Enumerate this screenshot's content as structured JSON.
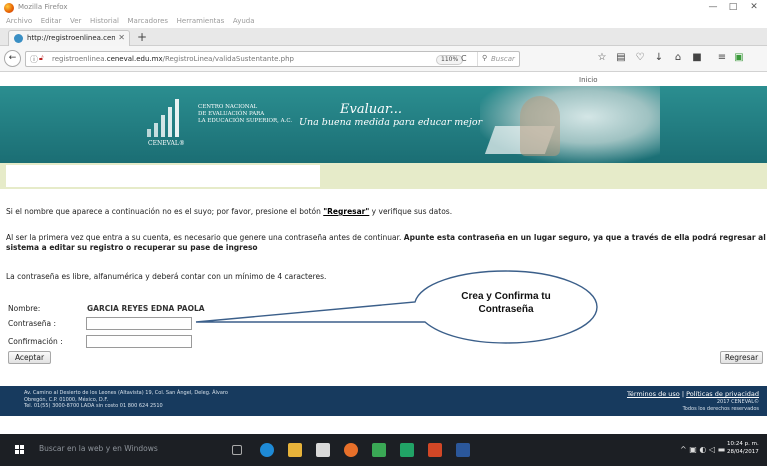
{
  "window": {
    "title": "Mozilla Firefox",
    "minimize": "—",
    "maximize": "□",
    "close": "✕"
  },
  "menu": [
    "Archivo",
    "Editar",
    "Ver",
    "Historial",
    "Marcadores",
    "Herramientas",
    "Ayuda"
  ],
  "tab": {
    "title": "http://registroenlinea.cenev",
    "close": "✕",
    "new_tab": "+"
  },
  "nav": {
    "back": "←",
    "url_domain_prefix": "registroenlinea.",
    "url_domain": "ceneval.edu.mx",
    "url_path": "/RegistroLinea/validaSustentante.php",
    "zoom": "110%",
    "reload": "C",
    "search_placeholder": "Buscar"
  },
  "top_link": "Inicio",
  "banner": {
    "org_line1": "CENTRO NACIONAL",
    "org_line2": "DE EVALUACIÓN PARA",
    "org_line3": "LA EDUCACIÓN SUPERIOR, A.C.",
    "brand": "CENEVAL®",
    "slogan1": "Evaluar...",
    "slogan2": "Una buena medida para educar mejor"
  },
  "content": {
    "p1_before": "Si el nombre que aparece a continuación no es el suyo; por favor, presione el botón ",
    "p1_link": "\"Regresar\"",
    "p1_after": " y verifique sus datos.",
    "p2_normal": "Al ser la primera vez que entra a su cuenta, es necesario que genere una contraseña antes de continuar. ",
    "p2_bold": "Apunte esta contraseña en un lugar seguro, ya que a través de ella podrá regresar al sistema a editar su registro o recuperar su pase de ingreso",
    "p3": "La contraseña es libre, alfanumérica y deberá contar con un mínimo de 4 caracteres."
  },
  "form": {
    "nombre_label": "Nombre:",
    "nombre_value": "GARCIA REYES EDNA PAOLA",
    "password_label": "Contraseña :",
    "confirm_label": "Confirmación :",
    "password_value": "",
    "confirm_value": "",
    "submit": "Aceptar",
    "back": "Regresar"
  },
  "callout": {
    "line1": "Crea y Confirma tu",
    "line2": "Contraseña"
  },
  "footer": {
    "addr1": "Av. Camino al Desierto de los Leones (Altavista) 19, Col. San Ángel, Deleg. Álvaro",
    "addr2": "Obregón, C.P. 01000, México, D.F.",
    "addr3": "Tel. 01(55) 3000-8700 LADA sin costo 01 800 624 2510",
    "terms": "Términos de uso",
    "sep": " | ",
    "privacy": "Políticas de privacidad",
    "copy1": "2017 CENEVAL©",
    "copy2": "Todos los derechos reservados"
  },
  "taskbar": {
    "search": "Buscar en la web y en Windows",
    "time": "10:24 p. m.",
    "date": "28/04/2017"
  },
  "colors": {
    "banner": "#1f7a7e",
    "strip": "#e6ebc9",
    "footer": "#173a5e",
    "callout_fill": "#ffffff",
    "callout_stroke": "#3b5f8a"
  }
}
